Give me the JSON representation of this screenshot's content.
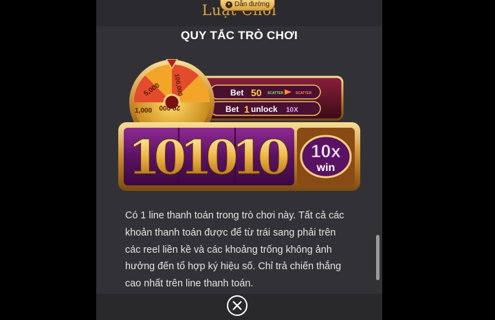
{
  "header": {
    "title": "Luật Chơi",
    "guide_label": "Dẫn đường"
  },
  "section_title": "QUY TẮC TRÒ CHƠI",
  "slot": {
    "wheel_values": [
      "5,000",
      "100,000",
      "20,000",
      "1,000"
    ],
    "bet_line_1": {
      "prefix": "Bet",
      "value": "50",
      "scatter_label": "SCATTER"
    },
    "bet_line_2": {
      "prefix": "Bet",
      "value": "1",
      "suffix": "unlock",
      "multiplier": "10X"
    },
    "reel_digits": "101010",
    "win_multiplier": "10x",
    "win_label": "win"
  },
  "rules_text": "Có 1 line thanh toán trong trò chơi này. Tất cả các khoản thanh toán được để từ trái sang phải trên các reel liền kề và các khoảng trống không ảnh hưởng đến tổ hợp ký hiệu số. Chỉ trả chiến thắng cao nhất trên line thanh toán.",
  "colors": {
    "page_bg": "#323236",
    "accent_gold": "#d9a44a",
    "reel_purple": "#6b1a72",
    "wheel_red": "#c0392b"
  },
  "icons": {
    "close": "close-icon",
    "guide": "chevron-down-icon"
  }
}
